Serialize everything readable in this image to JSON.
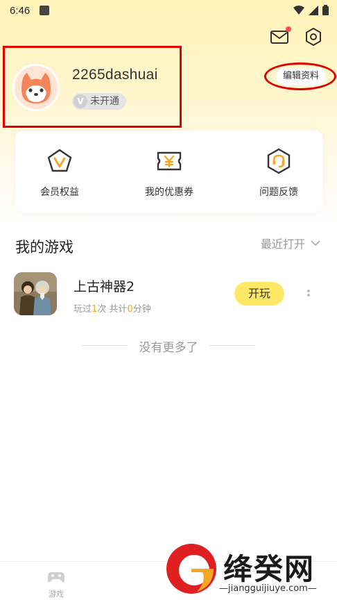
{
  "status_bar": {
    "time": "6:46"
  },
  "profile": {
    "username": "2265dashuai",
    "vip_status": "未开通",
    "vip_badge_letter": "V",
    "edit_label": "编辑资料"
  },
  "quick_actions": [
    {
      "label": "会员权益",
      "icon": "vip-pentagon-icon"
    },
    {
      "label": "我的优惠券",
      "icon": "coupon-icon"
    },
    {
      "label": "问题反馈",
      "icon": "headset-icon"
    }
  ],
  "my_games": {
    "title": "我的游戏",
    "sort_label": "最近打开",
    "games": [
      {
        "title": "上古神器2",
        "stats_prefix": "玩过",
        "times": "1",
        "times_unit": "次 共计",
        "minutes": "0",
        "minutes_unit": "分钟",
        "play_label": "开玩"
      }
    ],
    "end_text": "没有更多了"
  },
  "bottom_nav": [
    {
      "label": "游戏",
      "icon": "gamepad-icon"
    }
  ],
  "watermark": {
    "text": "绛癸网",
    "url": "—jiangguijiuye.com—"
  },
  "colors": {
    "accent_yellow": "#ffe866",
    "highlight_orange": "#f5a623",
    "annotation_red": "#e00000"
  }
}
